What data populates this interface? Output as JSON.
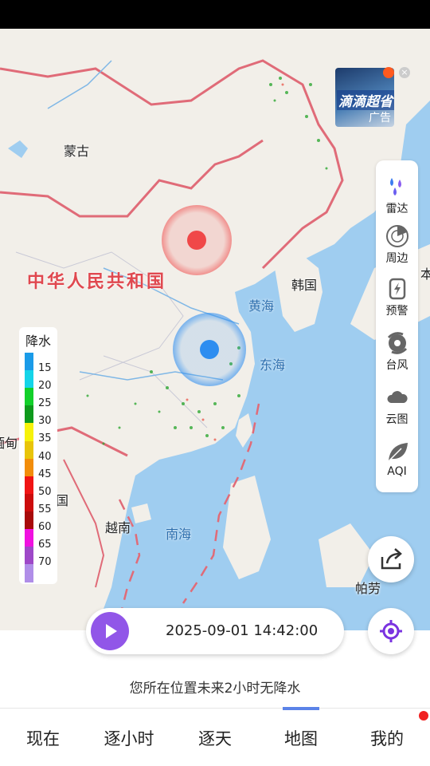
{
  "map": {
    "labels": {
      "mongolia": "蒙古",
      "china": "中华人民共和国",
      "korea": "韩国",
      "yellow_sea": "黄海",
      "east_sea": "东海",
      "vietnam": "越南",
      "south_sea": "南海",
      "myanmar_partial": "缅甸",
      "guo_partial": "国",
      "ri_partial": "本",
      "palau_partial": "帕劳"
    },
    "colors": {
      "water": "#9fcdf0",
      "land": "#f2efe9",
      "border": "#e06b78",
      "marker_red": "#f04848",
      "marker_blue": "#2d8df0"
    }
  },
  "ad": {
    "text": "滴滴超省",
    "sub": "广告",
    "close": "×"
  },
  "tools": [
    {
      "icon": "radar-rain-icon",
      "label": "雷达"
    },
    {
      "icon": "nearby-radar-icon",
      "label": "周边"
    },
    {
      "icon": "warning-phone-icon",
      "label": "预警"
    },
    {
      "icon": "typhoon-icon",
      "label": "台风"
    },
    {
      "icon": "cloud-icon",
      "label": "云图"
    },
    {
      "icon": "leaf-icon",
      "label": "AQI"
    }
  ],
  "legend": {
    "title": "降水",
    "values": [
      "15",
      "20",
      "25",
      "30",
      "35",
      "40",
      "45",
      "50",
      "55",
      "60",
      "65",
      "70"
    ],
    "colors": [
      "#1a9be8",
      "#14d4e8",
      "#12d02a",
      "#0e9a1c",
      "#f6f20a",
      "#e8c40a",
      "#f28d0a",
      "#f01414",
      "#cc0c0c",
      "#a80a0a",
      "#f010e0",
      "#9e48c8",
      "#b08ee8"
    ]
  },
  "player": {
    "timestamp": "2025-09-01 14:42:00"
  },
  "status_note": "您所在位置未来2小时无降水",
  "tabs": [
    {
      "label": "现在"
    },
    {
      "label": "逐小时"
    },
    {
      "label": "逐天"
    },
    {
      "label": "地图",
      "active": true
    },
    {
      "label": "我的"
    }
  ]
}
